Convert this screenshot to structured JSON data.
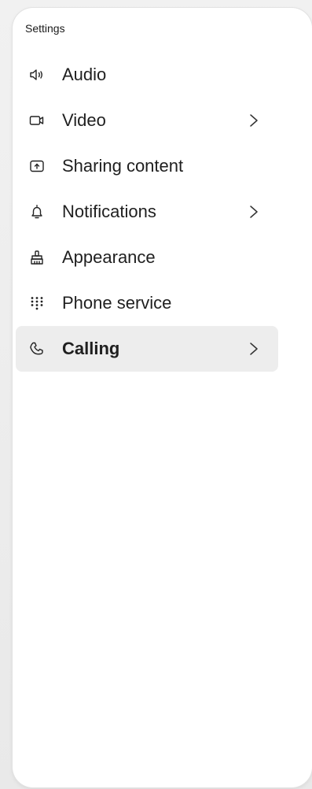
{
  "panel": {
    "title": "Settings"
  },
  "menu": {
    "items": [
      {
        "label": "Audio",
        "icon": "speaker-icon",
        "has_submenu": false,
        "active": false
      },
      {
        "label": "Video",
        "icon": "video-camera-icon",
        "has_submenu": true,
        "active": false
      },
      {
        "label": "Sharing content",
        "icon": "share-screen-icon",
        "has_submenu": false,
        "active": false
      },
      {
        "label": "Notifications",
        "icon": "bell-icon",
        "has_submenu": true,
        "active": false
      },
      {
        "label": "Appearance",
        "icon": "paint-brush-icon",
        "has_submenu": false,
        "active": false
      },
      {
        "label": "Phone service",
        "icon": "dialpad-icon",
        "has_submenu": false,
        "active": false
      },
      {
        "label": "Calling",
        "icon": "phone-icon",
        "has_submenu": true,
        "active": true
      }
    ]
  },
  "colors": {
    "active_background": "#ededed",
    "text": "#1f1f1f",
    "panel_background": "#ffffff"
  }
}
